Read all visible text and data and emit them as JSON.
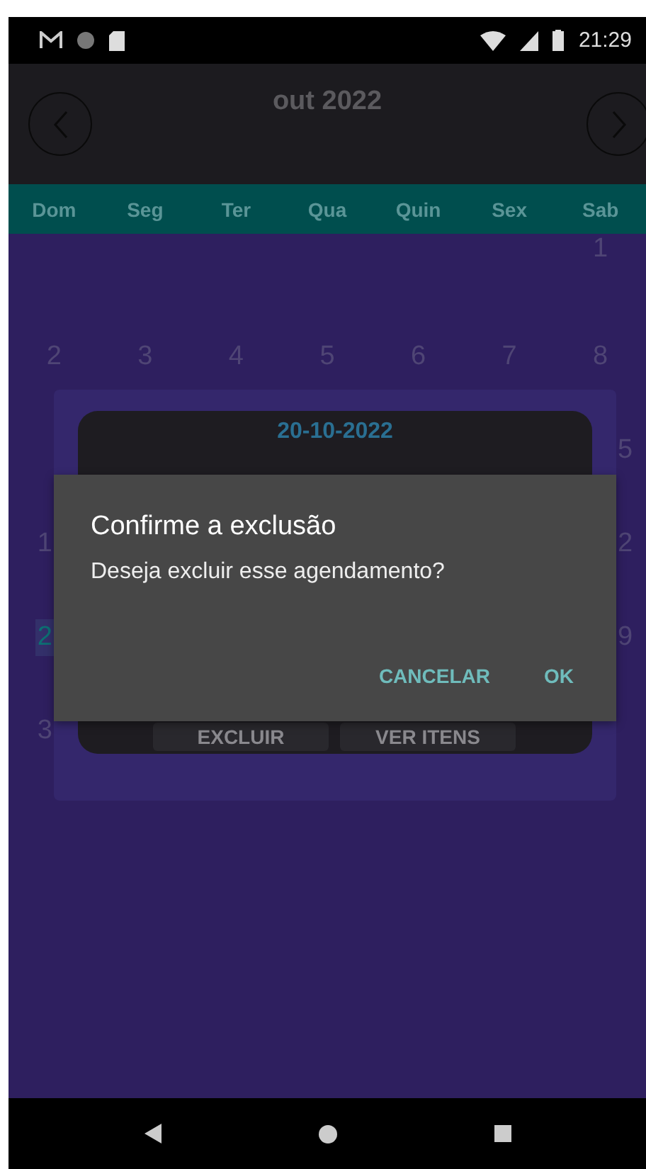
{
  "status_bar": {
    "time": "21:29"
  },
  "header": {
    "title": "out 2022"
  },
  "weekdays": [
    "Dom",
    "Seg",
    "Ter",
    "Qua",
    "Quin",
    "Sex",
    "Sab"
  ],
  "weeks": [
    {
      "days": [
        {
          "kind": "empty"
        },
        {
          "kind": "empty"
        },
        {
          "kind": "empty"
        },
        {
          "kind": "empty"
        },
        {
          "kind": "empty"
        },
        {
          "kind": "empty"
        },
        {
          "kind": "day",
          "text": "1"
        }
      ]
    },
    {
      "days": [
        {
          "kind": "day",
          "text": "2"
        },
        {
          "kind": "day",
          "text": "3"
        },
        {
          "kind": "day",
          "text": "4"
        },
        {
          "kind": "day",
          "text": "5"
        },
        {
          "kind": "day",
          "text": "6"
        },
        {
          "kind": "day",
          "text": "7"
        },
        {
          "kind": "day",
          "text": "8"
        }
      ]
    }
  ],
  "covered_rows": [
    {
      "right": {
        "text": "5",
        "today": false
      }
    },
    {
      "left": {
        "text": "1",
        "today": false
      },
      "right": {
        "text": "2",
        "today": false
      }
    },
    {
      "left": {
        "text": "2",
        "today": true
      },
      "right": {
        "text": "9",
        "today": false
      }
    },
    {
      "left": {
        "text": "3",
        "today": false
      }
    }
  ],
  "event_card": {
    "date": "20-10-2022",
    "buttons": [
      "EXCLUIR",
      "VER ITENS"
    ]
  },
  "dialog": {
    "title": "Confirme a exclusão",
    "message": "Deseja excluir esse agendamento?",
    "buttons": [
      "CANCELAR",
      "OK"
    ]
  }
}
